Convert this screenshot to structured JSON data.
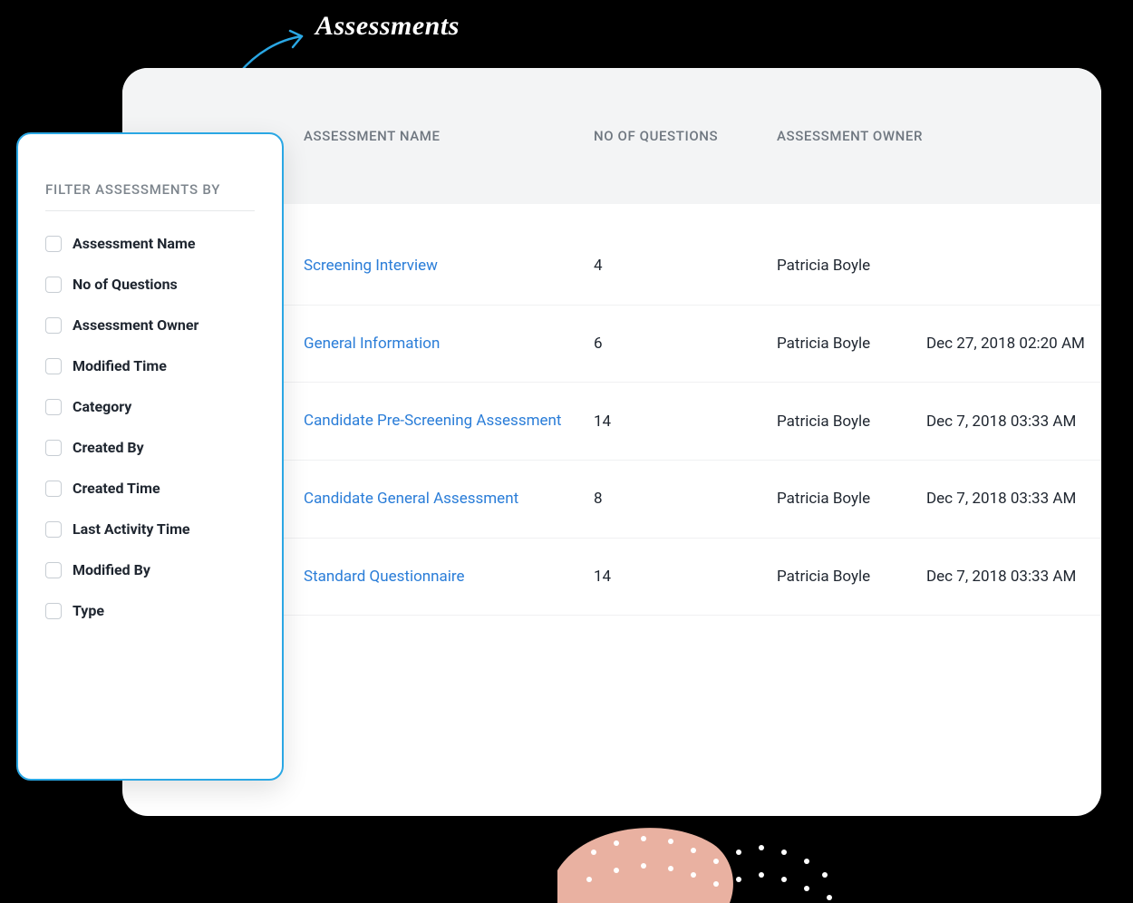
{
  "annotation": {
    "label": "Assessments"
  },
  "filter": {
    "title": "FILTER ASSESSMENTS BY",
    "items": [
      {
        "label": "Assessment Name"
      },
      {
        "label": "No of Questions"
      },
      {
        "label": "Assessment Owner"
      },
      {
        "label": "Modified Time"
      },
      {
        "label": "Category"
      },
      {
        "label": "Created By"
      },
      {
        "label": "Created Time"
      },
      {
        "label": "Last Activity Time"
      },
      {
        "label": "Modified By"
      },
      {
        "label": "Type"
      }
    ]
  },
  "table": {
    "headers": {
      "name": "ASSESSMENT NAME",
      "questions": "NO OF QUESTIONS",
      "owner": "ASSESSMENT OWNER"
    },
    "rows": [
      {
        "name": "Screening Interview",
        "questions": "4",
        "owner": "Patricia Boyle",
        "time": ""
      },
      {
        "name": "General Information",
        "questions": "6",
        "owner": "Patricia Boyle",
        "time": "Dec 27, 2018 02:20 AM"
      },
      {
        "name": "Candidate Pre-Screening Assessment",
        "questions": "14",
        "owner": "Patricia Boyle",
        "time": "Dec 7, 2018 03:33 AM"
      },
      {
        "name": "Candidate General Assessment",
        "questions": "8",
        "owner": "Patricia Boyle",
        "time": "Dec 7, 2018 03:33 AM"
      },
      {
        "name": "Standard Questionnaire",
        "questions": "14",
        "owner": "Patricia Boyle",
        "time": "Dec 7, 2018 03:33 AM"
      }
    ]
  }
}
